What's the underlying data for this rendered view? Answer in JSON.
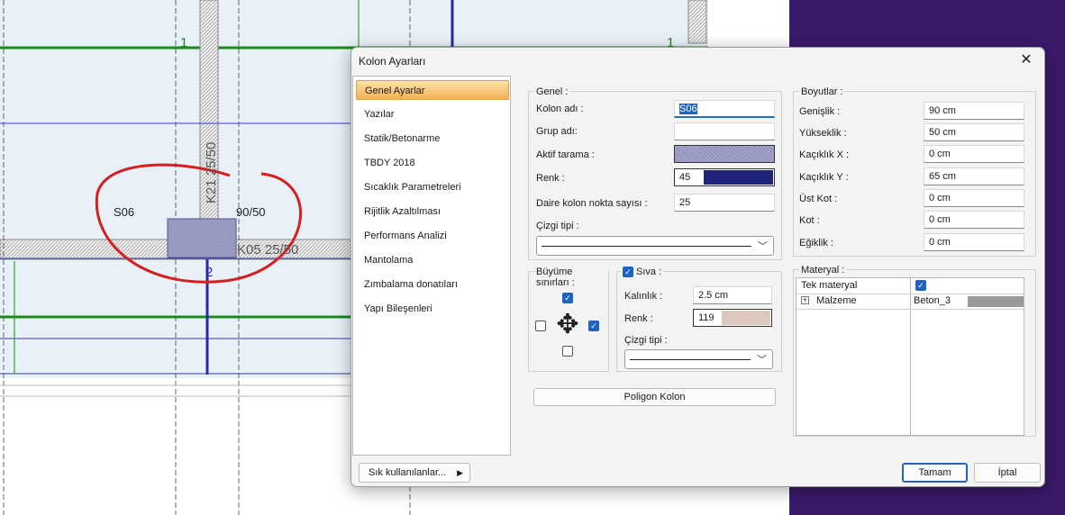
{
  "cad": {
    "label_s06": "S06",
    "label_9050": "90/50",
    "label_k21": "K21 25/50",
    "label_k05": "K05 25/50",
    "axis_1_left": "1",
    "axis_1_right": "1",
    "axis_2": "2"
  },
  "dialog": {
    "title": "Kolon Ayarları",
    "close_glyph": "✕"
  },
  "nav": {
    "items": [
      {
        "label": "Genel Ayarlar",
        "active": true
      },
      {
        "label": "Yazılar"
      },
      {
        "label": "Statik/Betonarme"
      },
      {
        "label": "TBDY 2018"
      },
      {
        "label": "Sıcaklık Parametreleri"
      },
      {
        "label": "Rijitlik Azaltılması"
      },
      {
        "label": "Performans Analizi"
      },
      {
        "label": "Mantolama"
      },
      {
        "label": "Zımbalama donatıları"
      },
      {
        "label": "Yapı Bileşenleri"
      }
    ]
  },
  "genel": {
    "title": "Genel :",
    "kolon_adi_label": "Kolon adı :",
    "kolon_adi_value": "S06",
    "grup_adi_label": "Grup adı:",
    "grup_adi_value": "",
    "aktif_tarama_label": "Aktif tarama :",
    "renk_label": "Renk :",
    "renk_value": "45",
    "renk_color": "#1f237a",
    "daire_label": "Daire kolon nokta sayısı :",
    "daire_value": "25",
    "cizgi_tipi_label": "Çizgi tipi :"
  },
  "boyutlar": {
    "title": "Boyutlar :",
    "rows": [
      {
        "label": "Genişlik :",
        "value": "90 cm"
      },
      {
        "label": "Yükseklik :",
        "value": "50 cm"
      },
      {
        "label": "Kaçıklık X :",
        "value": "0 cm"
      },
      {
        "label": "Kaçıklık Y :",
        "value": "65 cm"
      },
      {
        "label": "Üst Kot :",
        "value": "0 cm"
      },
      {
        "label": "Kot :",
        "value": "0 cm"
      },
      {
        "label": "Eğiklik :",
        "value": "0 cm"
      }
    ]
  },
  "buyume": {
    "title": "Büyüme sınırları :"
  },
  "siva": {
    "title": "Sıva :",
    "kalinlik_label": "Kalınlık :",
    "kalinlik_value": "2.5 cm",
    "renk_label": "Renk :",
    "renk_value": "119",
    "renk_color": "#ddc8bd",
    "cizgi_tipi_label": "Çizgi tipi :"
  },
  "polygon_button": "Poligon Kolon",
  "materyal": {
    "title": "Materyal :",
    "tek_materyal_label": "Tek materyal",
    "malzeme_label": "Malzeme",
    "malzeme_value": "Beton_3",
    "expand_glyph": "+"
  },
  "footer": {
    "sik_label": "Sık kullanılanlar...",
    "tamam": "Tamam",
    "iptal": "İptal"
  }
}
